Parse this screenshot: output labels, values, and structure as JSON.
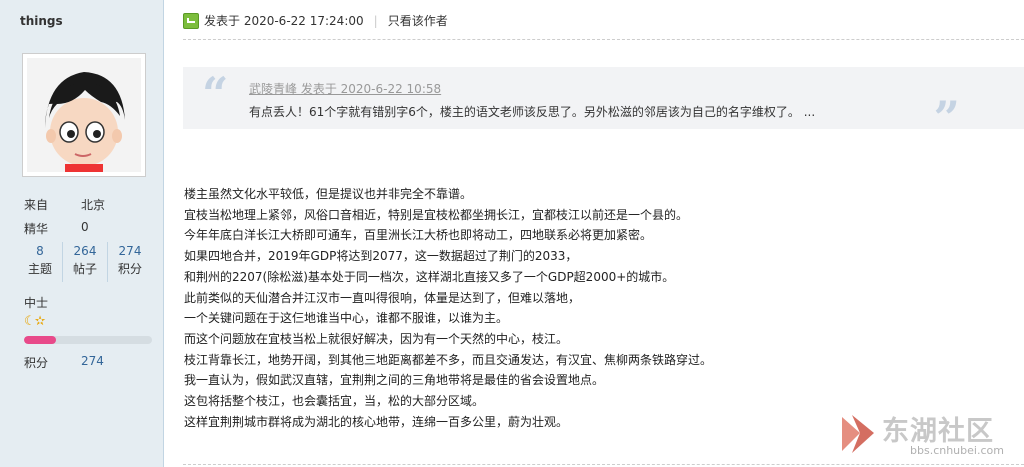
{
  "user": {
    "name": "things",
    "from_label": "来自",
    "from_value": "北京",
    "digest_label": "精华",
    "digest_value": "0",
    "stats": [
      {
        "num": "8",
        "label": "主题"
      },
      {
        "num": "264",
        "label": "帖子"
      },
      {
        "num": "274",
        "label": "积分"
      }
    ],
    "rank": "中士",
    "rank_icons": [
      "moon-icon",
      "star-icon"
    ],
    "progress_fraction": 0.25,
    "points_label": "积分",
    "points_value": "274"
  },
  "post": {
    "posted_at": "发表于 2020-6-22 17:24:00",
    "only_author": "只看该作者",
    "quote": {
      "header": "武陵青峰 发表于 2020-6-22 10:58",
      "body": "有点丢人！61个字就有错别字6个，楼主的语文老师该反思了。另外松滋的邻居该为自己的名字维权了。 ..."
    },
    "lines": [
      "楼主虽然文化水平较低，但是提议也并非完全不靠谱。",
      "宜枝当松地理上紧邻，风俗口音相近，特别是宜枝松都坐拥长江，宜都枝江以前还是一个县的。",
      "今年年底白洋长江大桥即可通车，百里洲长江大桥也即将动工，四地联系必将更加紧密。",
      "如果四地合并，2019年GDP将达到2077，这一数据超过了荆门的2033，",
      "和荆州的2207(除松滋)基本处于同一档次，这样湖北直接又多了一个GDP超2000+的城市。",
      "此前类似的天仙潜合并江汉市一直叫得很响，体量是达到了，但难以落地，",
      "一个关键问题在于这仨地谁当中心，谁都不服谁，以谁为主。",
      "而这个问题放在宜枝当松上就很好解决，因为有一个天然的中心，枝江。",
      "枝江背靠长江，地势开阔，到其他三地距离都差不多，而且交通发达，有汉宜、焦柳两条铁路穿过。",
      "我一直认为，假如武汉直辖，宜荆荆之间的三角地带将是最佳的省会设置地点。",
      "这包将括整个枝江，也会囊括宜，当，松的大部分区域。",
      "这样宜荆荆城市群将成为湖北的核心地带，连绵一百多公里，蔚为壮观。"
    ]
  },
  "watermark": {
    "name": "东湖社区",
    "url": "bbs.cnhubei.com"
  },
  "colors": {
    "sidebar_bg": "#e5edf2",
    "link": "#336699",
    "progress": "#e84a8a"
  }
}
